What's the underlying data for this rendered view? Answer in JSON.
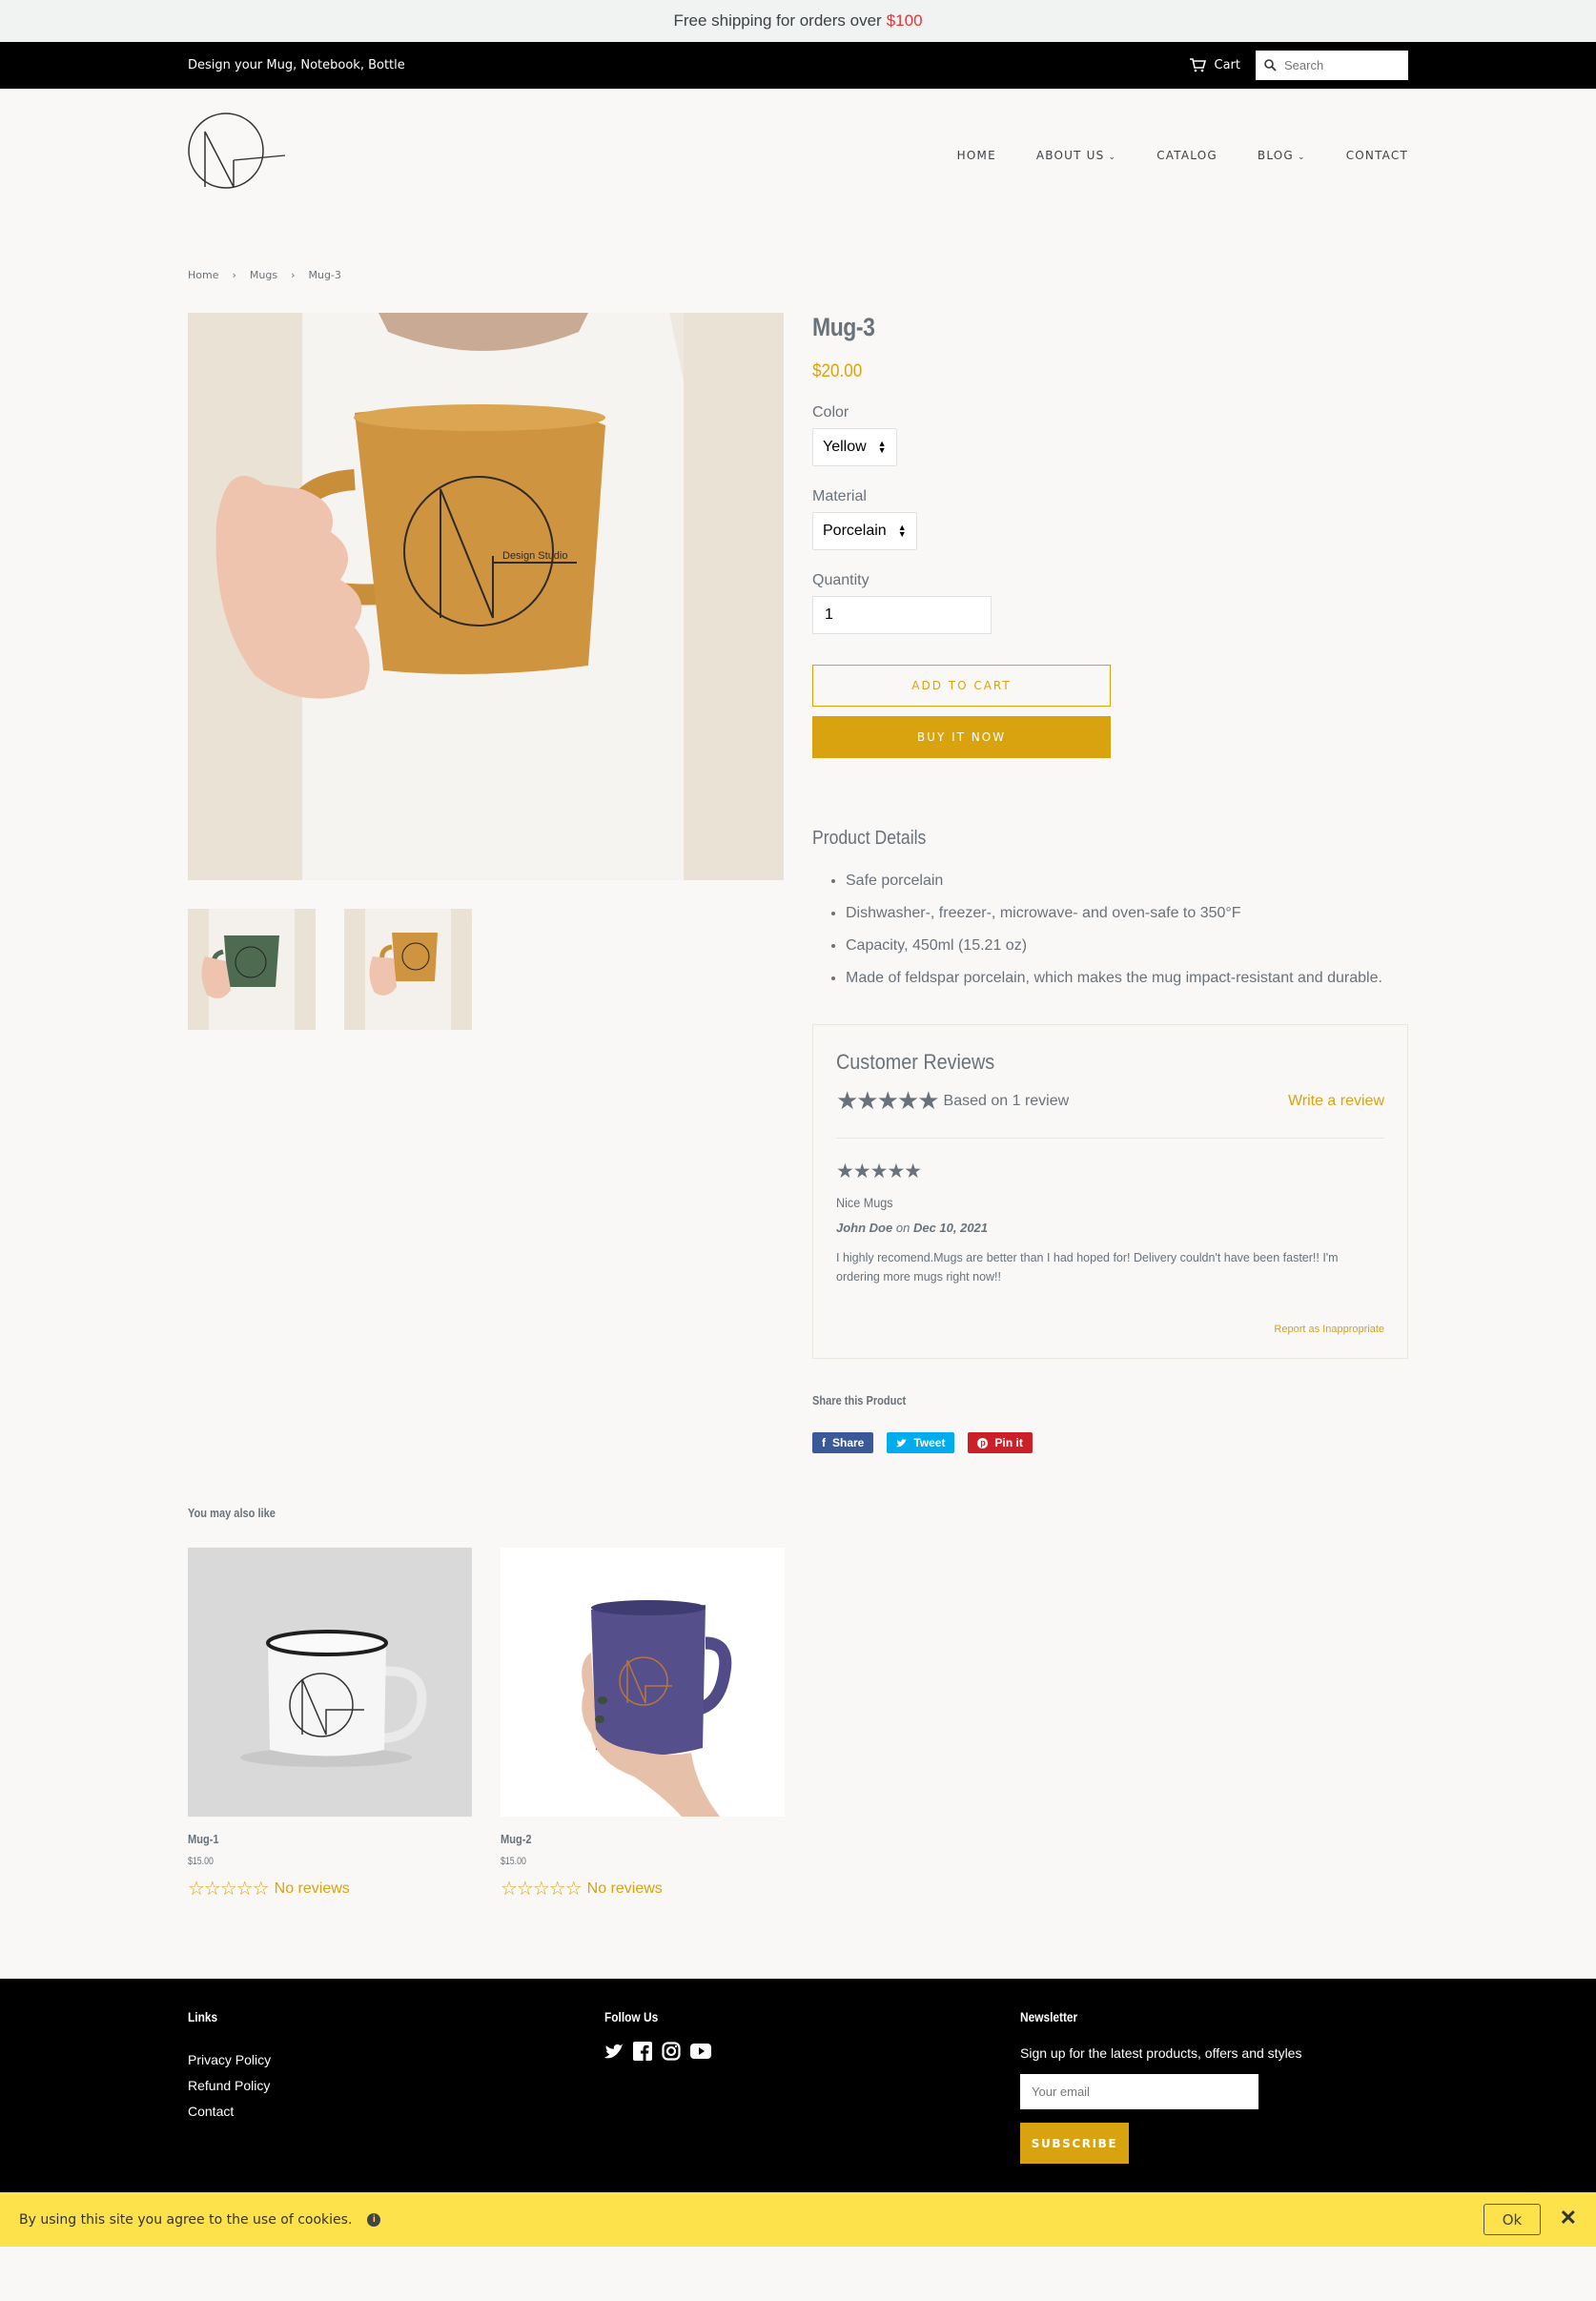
{
  "announcement": {
    "text": "Free shipping for orders over",
    "highlight": "$100",
    "highlight_color": "#e2353b"
  },
  "topbar": {
    "tagline": "Design your Mug, Notebook, Bottle",
    "cart_label": "Cart",
    "search_placeholder": "Search"
  },
  "nav": {
    "items": [
      "HOME",
      "ABOUT US",
      "CATALOG",
      "BLOG",
      "CONTACT"
    ]
  },
  "breadcrumb": {
    "items": [
      "Home",
      "Mugs",
      "Mug-3"
    ]
  },
  "product": {
    "title": "Mug-3",
    "price": "$20.00",
    "color_label": "Color",
    "color_value": "Yellow",
    "material_label": "Material",
    "material_value": "Porcelain",
    "quantity_label": "Quantity",
    "quantity_value": "1",
    "add_to_cart": "ADD TO CART",
    "buy_now": "BUY IT NOW",
    "details_title": "Product Details",
    "details": [
      "Safe porcelain",
      "Dishwasher-, freezer-, microwave- and oven-safe to 350°F",
      "Capacity, 450ml (15.21 oz)",
      "Made of feldspar porcelain, which makes the mug impact-resistant and durable."
    ],
    "logo_text": "Design Studio"
  },
  "reviews": {
    "title": "Customer Reviews",
    "summary": "Based on 1 review",
    "rating": 5,
    "write_link": "Write a review",
    "items": [
      {
        "rating": 5,
        "headline": "Nice Mugs",
        "author": "John Doe",
        "on": "on",
        "date": "Dec 10, 2021",
        "body": "I highly recomend.Mugs are better than I had hoped for! Delivery couldn't have been faster!! I'm ordering more mugs right now!!",
        "report": "Report as Inappropriate"
      }
    ]
  },
  "share": {
    "title": "Share this Product",
    "facebook": "Share",
    "twitter": "Tweet",
    "pinterest": "Pin it"
  },
  "related": {
    "title": "You may also like",
    "items": [
      {
        "name": "Mug-1",
        "price": "$15.00",
        "reviews": "No reviews"
      },
      {
        "name": "Mug-2",
        "price": "$15.00",
        "reviews": "No reviews"
      }
    ]
  },
  "footer": {
    "links_title": "Links",
    "links": [
      "Privacy Policy",
      "Refund Policy",
      "Contact"
    ],
    "follow_title": "Follow Us",
    "newsletter_title": "Newsletter",
    "newsletter_text": "Sign up for the latest products, offers and styles",
    "email_placeholder": "Your email",
    "subscribe": "SUBSCRIBE"
  },
  "cookie": {
    "text": "By using this site you agree to the use of cookies.",
    "ok": "Ok"
  },
  "colors": {
    "accent": "#d8a30e",
    "text": "#69727b",
    "facebook": "#3b5998",
    "twitter": "#00aced",
    "pinterest": "#cb2027",
    "cookie_bg": "#fde24b"
  }
}
